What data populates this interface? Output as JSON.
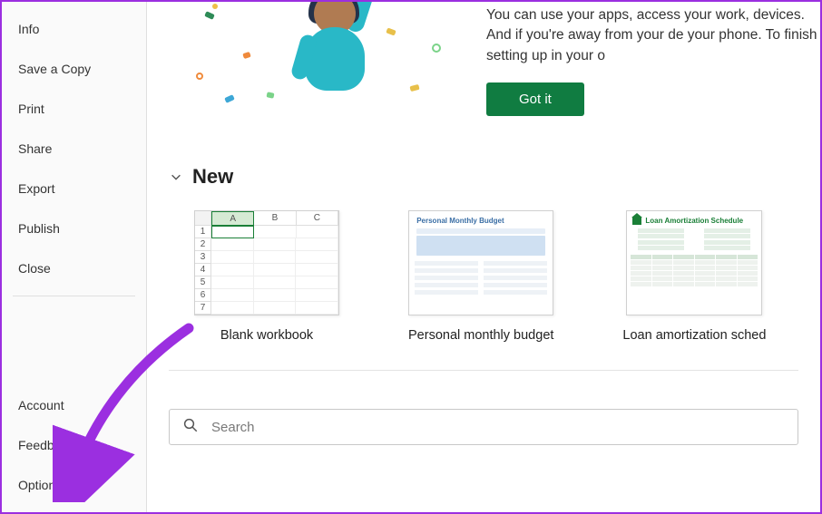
{
  "sidebar": {
    "top_items": [
      {
        "label": "Info"
      },
      {
        "label": "Save a Copy"
      },
      {
        "label": "Print"
      },
      {
        "label": "Share"
      },
      {
        "label": "Export"
      },
      {
        "label": "Publish"
      },
      {
        "label": "Close"
      }
    ],
    "bottom_items": [
      {
        "label": "Account"
      },
      {
        "label": "Feedback"
      },
      {
        "label": "Options"
      }
    ]
  },
  "banner": {
    "text": "You can use your apps, access your work, devices. And if you're away from your de your phone. To finish setting up in your o",
    "button_label": "Got it"
  },
  "new_section": {
    "header": "New",
    "templates": [
      {
        "label": "Blank workbook"
      },
      {
        "label": "Personal monthly budget"
      },
      {
        "label": "Loan amortization sched"
      }
    ],
    "thumb_budget_title": "Personal Monthly Budget",
    "thumb_loan_title": "Loan Amortization Schedule"
  },
  "search": {
    "placeholder": "Search"
  },
  "colors": {
    "accent_green": "#107c41",
    "annotation": "#9b2fe0"
  }
}
